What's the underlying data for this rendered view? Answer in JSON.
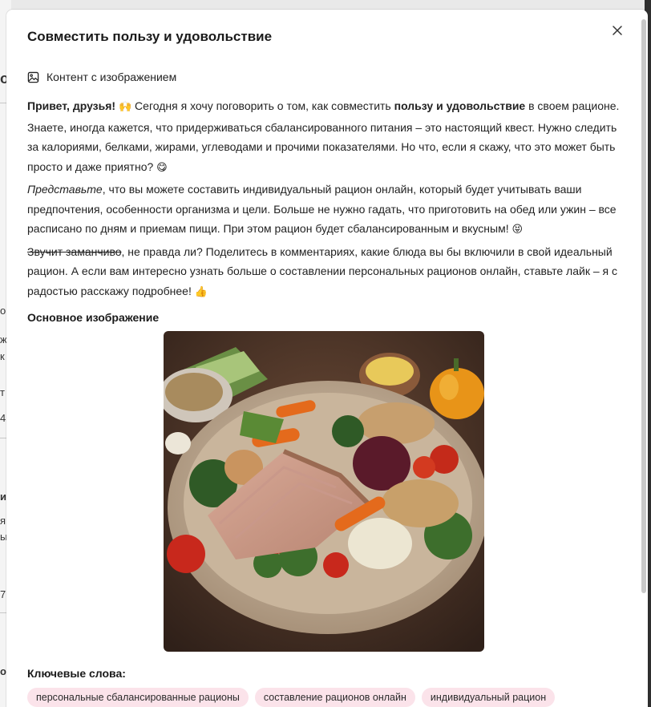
{
  "modal": {
    "title": "Совместить пользу и удовольствие",
    "content_type_label": "Контент с изображением"
  },
  "post": {
    "p1_bold": "Привет, друзья!",
    "p1_emoji1": "🙌",
    "p1_a": " Сегодня я хочу поговорить о том, как совместить ",
    "p1_bold2": "пользу и удовольствие",
    "p1_b": " в своем рационе. Знаете, иногда кажется, что придерживаться сбалансированного питания – это настоящий квест. Нужно следить за калориями, белками, жирами, углеводами и прочими показателями. Но что, если я скажу, что это может быть просто и даже приятно? ",
    "p1_emoji2": "😋",
    "p2_italic": "Представьте",
    "p2_a": ", что вы можете составить индивидуальный рацион онлайн, который будет учитывать ваши предпочтения, особенности организма и цели. Больше не нужно гадать, что приготовить на обед или ужин – все расписано по дням и приемам пищи. При этом рацион будет сбалансированным и вкусным! ",
    "p2_emoji": "😝",
    "p3_strike": "Звучит заманчиво",
    "p3_a": ", не правда ли? Поделитесь в комментариях, какие блюда вы бы включили в свой идеальный рацион. А если вам интересно узнать больше о составлении персональных рационов онлайн, ставьте лайк – я с радостью расскажу подробнее! ",
    "p3_emoji": "👍"
  },
  "main_image": {
    "label": "Основное изображение"
  },
  "keywords": {
    "label": "Ключевые слова:",
    "items": [
      "персональные сбалансированные рационы",
      "составление рационов онлайн",
      "индивидуальный рацион"
    ]
  },
  "background": {
    "fragments": [
      "о",
      "ж",
      "к",
      "т",
      "4",
      "и",
      "я",
      "ы",
      "7",
      "о"
    ]
  },
  "colors": {
    "tag_bg": "#fbe3ea",
    "modal_bg": "#ffffff",
    "overlay": "#3a3a3a"
  }
}
